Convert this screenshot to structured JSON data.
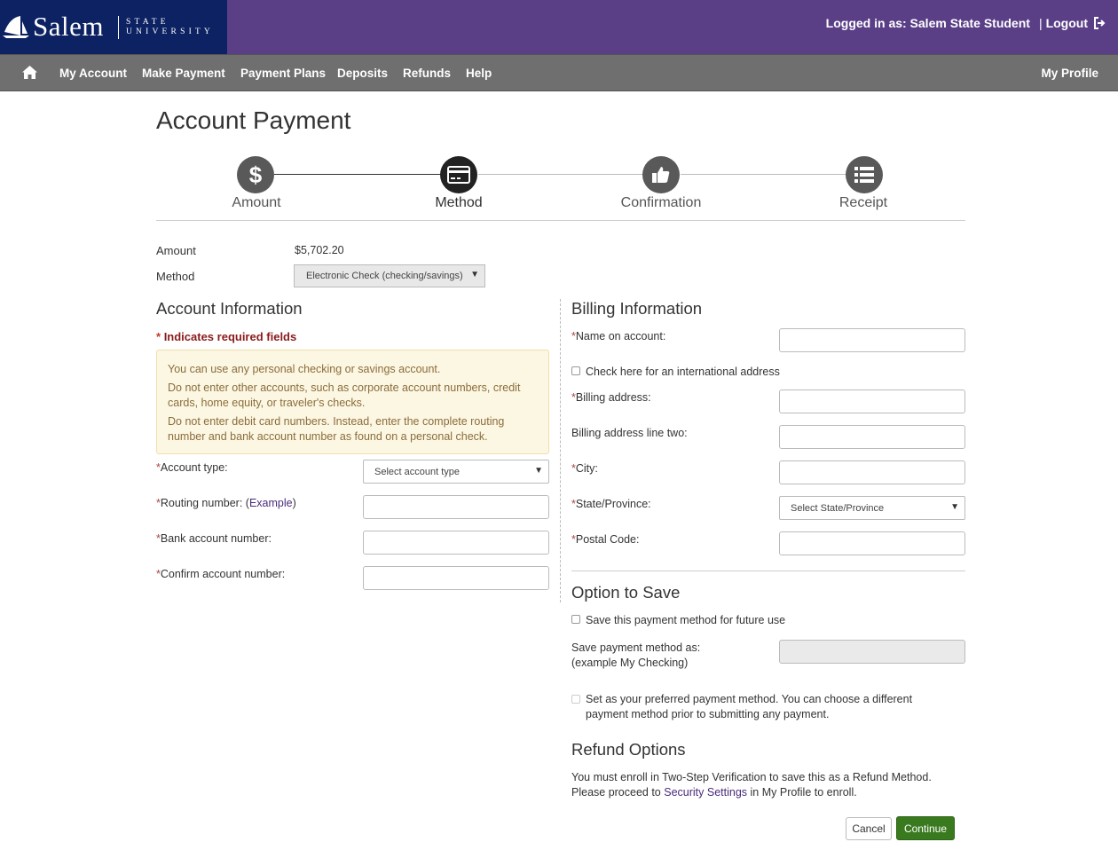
{
  "header": {
    "logo_word": "Salem",
    "logo_sub_1": "STATE",
    "logo_sub_2": "UNIVERSITY",
    "logged_in_text": "Logged in as: Salem State Student",
    "separator": "|",
    "logout_label": "Logout",
    "colors": {
      "brand_purple": "#5a3f87",
      "brand_navy": "#0c2262"
    }
  },
  "nav": {
    "home_icon": "home-icon",
    "items": [
      {
        "label": "My Account"
      },
      {
        "label": "Make Payment"
      },
      {
        "label": "Payment Plans"
      },
      {
        "label": "Deposits"
      },
      {
        "label": "Refunds"
      },
      {
        "label": "Help"
      }
    ],
    "profile_label": "My Profile"
  },
  "page": {
    "title": "Account Payment"
  },
  "stepper": {
    "steps": [
      {
        "label": "Amount",
        "icon": "dollar-icon"
      },
      {
        "label": "Method",
        "icon": "credit-card-icon",
        "active": true
      },
      {
        "label": "Confirmation",
        "icon": "thumbs-up-icon"
      },
      {
        "label": "Receipt",
        "icon": "list-icon"
      }
    ]
  },
  "summary": {
    "amount_label": "Amount",
    "amount_value": "$5,702.20",
    "method_label": "Method",
    "method_value": "Electronic Check (checking/savings)"
  },
  "account_info": {
    "heading": "Account Information",
    "required_star": "*",
    "required_note": "Indicates required fields",
    "notice": [
      "You can use any personal checking or savings account.",
      "Do not enter other accounts, such as corporate account numbers, credit cards, home equity, or traveler's checks.",
      "Do not enter debit card numbers. Instead, enter the complete routing number and bank account number as found on a personal check."
    ],
    "account_type_label": "Account type:",
    "account_type_placeholder": "Select account type",
    "routing_label": "Routing number: (",
    "routing_link": "Example",
    "routing_close": ")",
    "bank_account_label": "Bank account number:",
    "confirm_account_label": "Confirm account number:"
  },
  "billing": {
    "heading": "Billing Information",
    "name_label": "Name on account:",
    "intl_label": "Check here for an international address",
    "address_label": "Billing address:",
    "address2_label": "Billing address line two:",
    "city_label": "City:",
    "state_label": "State/Province:",
    "state_placeholder": "Select State/Province",
    "postal_label": "Postal Code:"
  },
  "save_option": {
    "heading": "Option to Save",
    "save_label": "Save this payment method for future use",
    "save_as_label_1": "Save payment method as:",
    "save_as_label_2": "(example My Checking)",
    "preferred_label": "Set as your preferred payment method. You can choose a different payment method prior to submitting any payment."
  },
  "refund": {
    "heading": "Refund Options",
    "text_1": "You must enroll in Two-Step Verification to save this as a Refund Method. Please proceed to ",
    "link": "Security Settings",
    "text_2": " in My Profile to enroll."
  },
  "actions": {
    "cancel_label": "Cancel",
    "continue_label": "Continue"
  },
  "star": "*"
}
